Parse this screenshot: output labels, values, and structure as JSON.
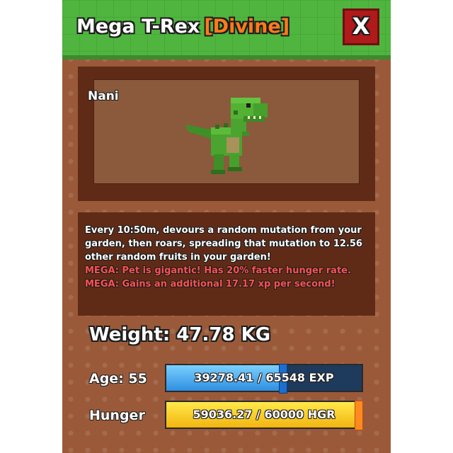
{
  "header": {
    "title": "Mega T-Rex",
    "rarity": "[Divine]",
    "close_label": "X"
  },
  "pet": {
    "name": "Nani",
    "model_icon": "trex-model-icon"
  },
  "description": {
    "ability": "Every 10:50m, devours a random mutation from your garden, then roars, spreading that mutation to 12.56 other random fruits in your garden!",
    "mega_lines": [
      "MEGA: Pet is gigantic! Has 20% faster hunger rate.",
      "MEGA: Gains an additional 17.17 xp per second!"
    ]
  },
  "stats": {
    "weight_text": "Weight: 47.78 KG",
    "age_label": "Age: 55",
    "exp_text": "39278.41 / 65548 EXP",
    "exp_fraction": 0.599,
    "hunger_label": "Hunger",
    "hunger_text": "59036.27 / 60000 HGR",
    "hunger_fraction": 0.984
  },
  "colors": {
    "panel": "#9a5a3a",
    "header": "#4fb53e",
    "rarity": "#ff7a1a",
    "mega_text": "#ff4f4f",
    "close_button": "#b01a1a",
    "exp_fill": "#2f8fe0",
    "hunger_fill": "#f2b511"
  }
}
